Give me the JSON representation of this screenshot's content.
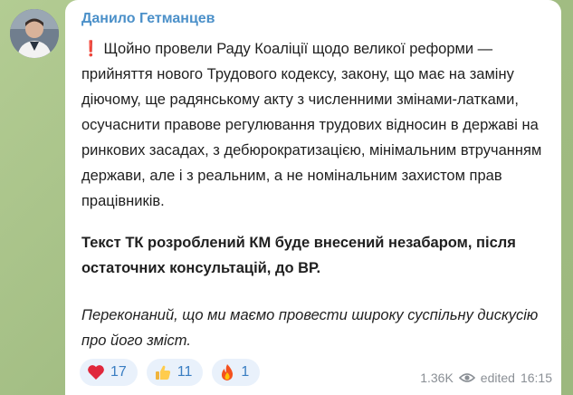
{
  "message": {
    "author": "Данило Гетманцев",
    "paragraph1": "Щойно провели Раду Коаліції щодо великої реформи — прийняття нового Трудового кодексу, закону, що має на заміну діючому, ще радянському акту з численними змінами-латками, осучаснити правове регулювання трудових відносин в державі на ринкових засадах, з дебюрократизацією, мінімальним втручанням держави, але і з реальним, а не номінальним захистом прав працівників.",
    "paragraph1_icon": "red-exclamation-icon",
    "paragraph1_icon_glyph": "❗",
    "paragraph2": "Текст ТК розроблений КМ буде внесений незабаром, після остаточних консультацій, до ВР.",
    "paragraph3": "Переконаний, що ми маємо провести широку суспільну дискусію про його зміст."
  },
  "reactions": [
    {
      "icon": "heart-icon",
      "count": "17"
    },
    {
      "icon": "thumbs-up-icon",
      "count": "11"
    },
    {
      "icon": "fire-icon",
      "count": "1"
    }
  ],
  "meta": {
    "views": "1.36K",
    "views_icon": "eye-icon",
    "edited_label": "edited",
    "time": "16:15"
  },
  "colors": {
    "author": "#4b90c9",
    "reaction_bg": "#e9f1fb",
    "reaction_text": "#3a7ec2",
    "wallpaper": "#a9c38b"
  }
}
